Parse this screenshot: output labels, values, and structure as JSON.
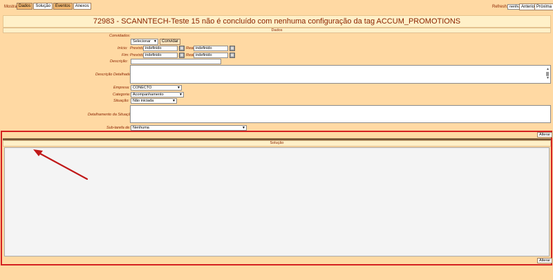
{
  "top": {
    "mostrar_label": "Mostrar:",
    "tabs": [
      "Dados",
      "Solução",
      "Eventos",
      "Anexos"
    ],
    "refresh_label": "Refresh:",
    "refresh_value": "nenhum",
    "prev_label": "Anterior",
    "next_label": "Próxima"
  },
  "title": "72983 - SCANNTECH-Teste 15 não é concluído com nenhuma configuração da tag ACCUM_PROMOTIONS",
  "dados_header": "Dados",
  "form": {
    "convidados_label": "Convidados:",
    "convidados_select": "Selecionar",
    "convidar_label": "Convidar",
    "inicio_label": "Início:",
    "fim_label": "Fim:",
    "previsto_label": "Previsto:",
    "real_label": "Real:",
    "inicio_previsto": "indefinido",
    "inicio_real": "indefinido",
    "fim_previsto": "indefinido",
    "fim_real": "indefinido",
    "descricao_label": "Descrição:",
    "descricao_detalhada_label": "Descrição Detalhada:",
    "empresa_label": "Empresa:",
    "empresa_value": "CONECTO",
    "categoria_label": "Categoria:",
    "categoria_value": "Acompanhamento",
    "situacao_label": "Situação:",
    "situacao_value": "Não iniciada",
    "detalhamento_label": "Detalhamento da Situação:",
    "subtarefa_label": "Sub-tarefa de:",
    "subtarefa_value": "Nenhuma"
  },
  "alterar_label": "Alterar",
  "solucao_header": "Solução",
  "alterar2_label": "Alterar",
  "colors": {
    "background": "#ffd9a3",
    "highlight_border": "#d42020",
    "arrow": "#c01818"
  }
}
